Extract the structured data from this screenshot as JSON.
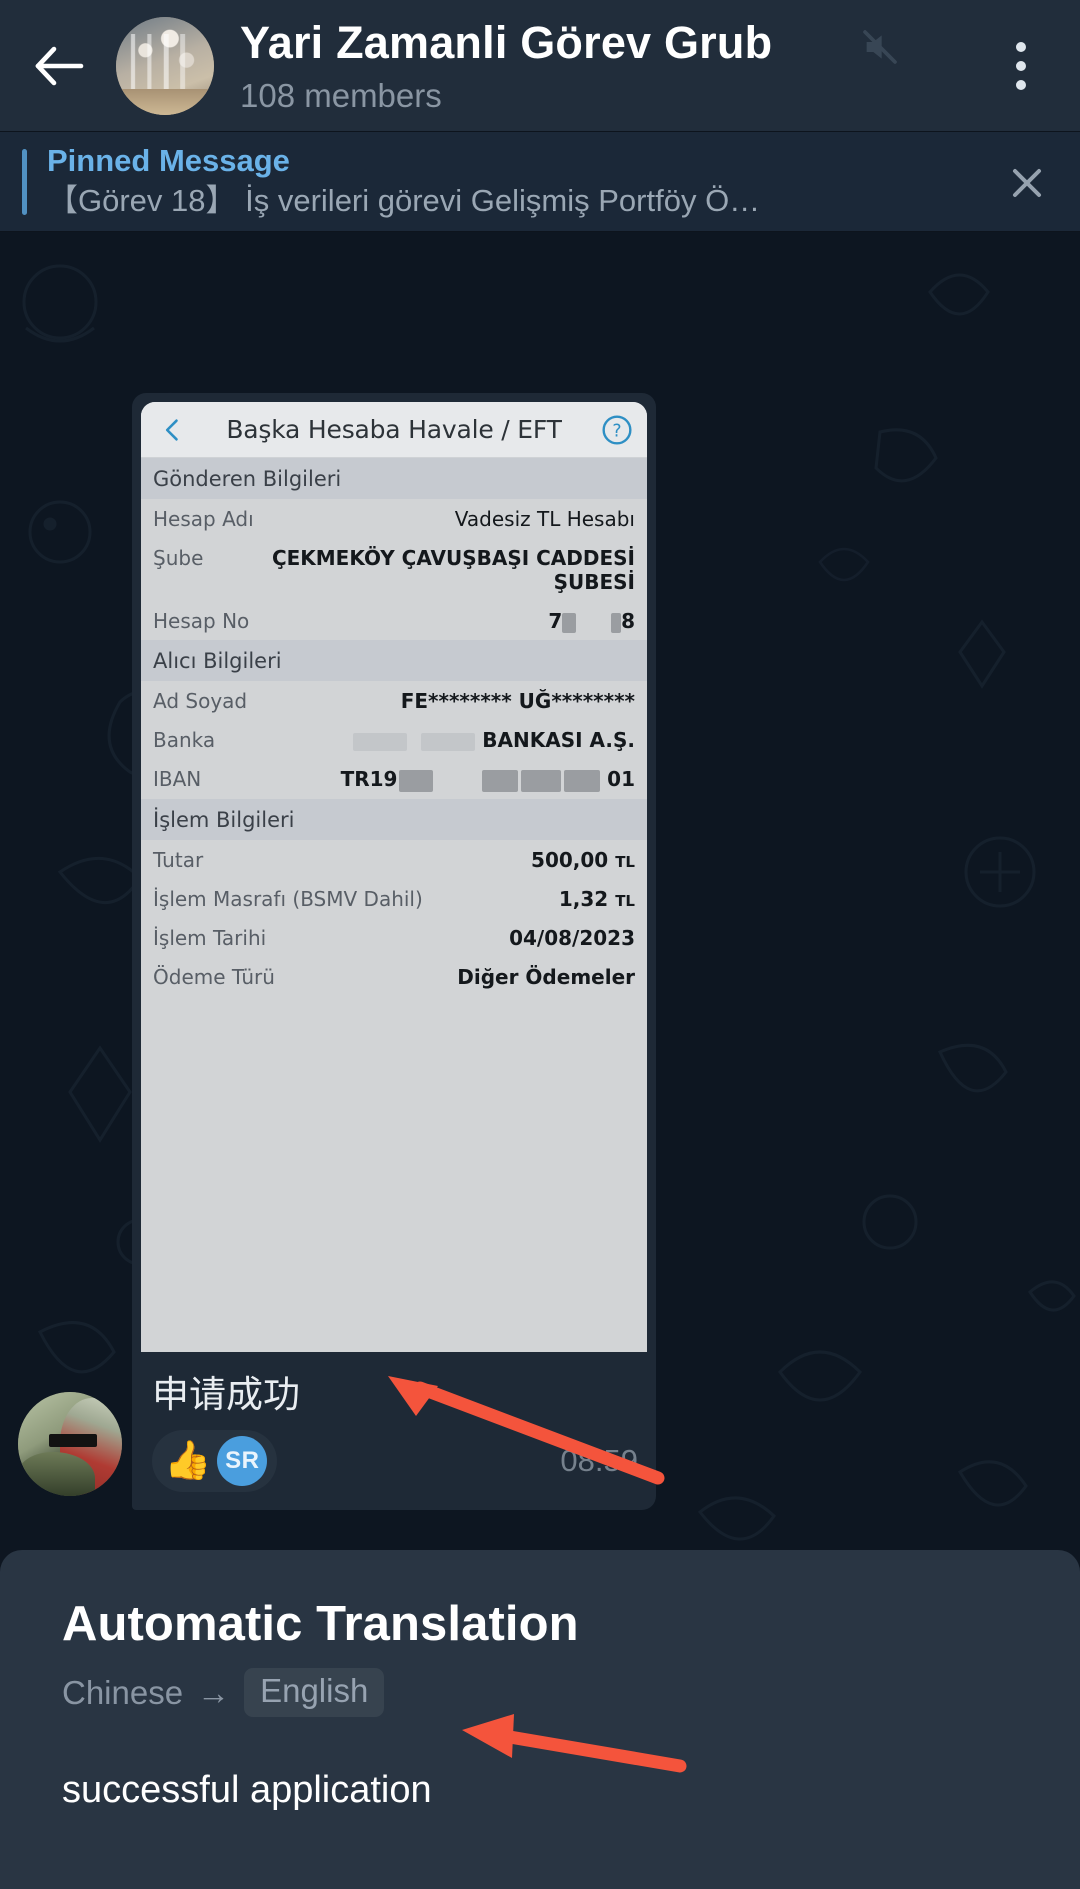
{
  "header": {
    "back_icon": "back-arrow-icon",
    "avatar": "group-avatar",
    "title": "Yari Zamanli Görev Grub",
    "mute_icon": "mute-icon",
    "members": "108 members",
    "menu_icon": "overflow-menu-icon"
  },
  "pinned": {
    "label": "Pinned Message",
    "text": "【Görev 18】 İş verileri görevi Gelişmiş Portföy Ö…",
    "close_icon": "close-icon"
  },
  "receipt": {
    "back_icon": "chevron-left-icon",
    "title": "Başka Hesaba Havale / EFT",
    "help_icon": "help-circle-icon",
    "sections": [
      {
        "heading": "Gönderen Bilgileri",
        "rows": [
          {
            "key": "Hesap Adı",
            "value": "Vadesiz TL Hesabı"
          },
          {
            "key": "Şube",
            "value": "ÇEKMEKÖY ÇAVUŞBAŞI CADDESİ ŞUBESİ"
          },
          {
            "key": "Hesap No",
            "value": "7▮    ▮8",
            "redacted": true
          }
        ]
      },
      {
        "heading": "Alıcı Bilgileri",
        "rows": [
          {
            "key": "Ad Soyad",
            "value": "FE******** UĞ********"
          },
          {
            "key": "Banka",
            "value": "BANKASI A.Ş.",
            "redacted": true
          },
          {
            "key": "IBAN",
            "value": "TR19 ▮▮▮    ▮▮▮▮▮▮▮ 01",
            "redacted": true
          }
        ]
      },
      {
        "heading": "İşlem Bilgileri",
        "rows": [
          {
            "key": "Tutar",
            "value": "500,00",
            "unit": "TL"
          },
          {
            "key": "İşlem Masrafı (BSMV Dahil)",
            "value": "1,32",
            "unit": "TL"
          },
          {
            "key": "İşlem Tarihi",
            "value": "04/08/2023"
          },
          {
            "key": "Ödeme Türü",
            "value": "Diğer Ödemeler"
          }
        ]
      }
    ]
  },
  "message": {
    "text": "申请成功",
    "reaction_emoji": "👍",
    "reaction_avatar_initials": "SR",
    "time": "08:59",
    "sender_avatar": "sender-avatar"
  },
  "translation": {
    "title": "Automatic Translation",
    "from": "Chinese",
    "arrow": "→",
    "to": "English",
    "body": "successful application"
  },
  "colors": {
    "header_bg": "#212d3b",
    "pinned_bg": "#1b2838",
    "pin_accent": "#5191c2",
    "pin_title": "#6ab2e8",
    "chat_bg": "#0d1621",
    "bubble_bg": "#1e2936",
    "sheet_bg": "#293543",
    "annotation_red": "#f4543c",
    "reaction_avatar": "#4a9ede"
  }
}
